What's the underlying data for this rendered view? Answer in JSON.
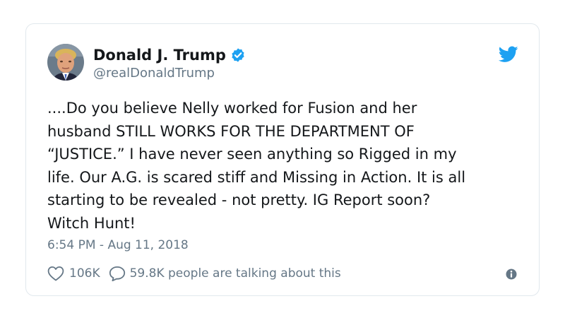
{
  "author": {
    "display_name": "Donald J. Trump",
    "handle": "@realDonaldTrump",
    "verified": true,
    "avatar_icon": "profile-photo"
  },
  "brand": {
    "logo_icon": "twitter-bird-icon",
    "accent_color": "#1da1f2"
  },
  "tweet": {
    "lines": [
      "....Do you believe Nelly worked for Fusion and her",
      "husband STILL WORKS FOR THE DEPARTMENT OF",
      "“JUSTICE.” I have never seen anything so Rigged in my",
      "life. Our A.G. is scared stiff and Missing in Action. It is all",
      "starting to be revealed - not pretty. IG Report soon?",
      "Witch Hunt!"
    ],
    "timestamp": "6:54 PM - Aug 11, 2018"
  },
  "actions": {
    "like_count": "106K",
    "reply_text": "59.8K people are talking about this",
    "info_icon": "info-icon"
  }
}
